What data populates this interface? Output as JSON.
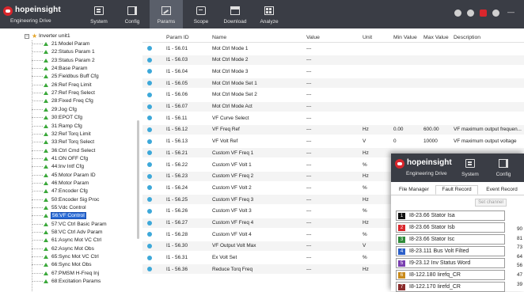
{
  "app": {
    "brand": "hopeinsight",
    "subtitle": "Engineering Drive"
  },
  "toolbar": [
    {
      "label": "System",
      "icon": "system-icon"
    },
    {
      "label": "Config",
      "icon": "config-icon"
    },
    {
      "label": "Params",
      "icon": "params-icon",
      "active": true
    },
    {
      "label": "Scope",
      "icon": "scope-icon"
    },
    {
      "label": "Download",
      "icon": "download-icon"
    },
    {
      "label": "Analyze",
      "icon": "analyze-icon"
    }
  ],
  "window_controls": {
    "minimize": "—"
  },
  "tree": {
    "root": "Inverter unit1",
    "items": [
      "21:Model Param",
      "22:Status Param 1",
      "23:Status Param 2",
      "24:Base Param",
      "25:Fieldbus Buff Cfg",
      "26:Ref Freq Limit",
      "27:Ref Freq Select",
      "28:Fixed Freq Cfg",
      "29:Jog Cfg",
      "30:EPOT Cfg",
      "31:Ramp Cfg",
      "32:Ref Torq Limit",
      "33:Ref Torq Select",
      "36:Ctrl Cmd Select",
      "41:ON OFF Cfg",
      "44:Inv Intf Cfg",
      "45:Motor Param ID",
      "46:Motor Param",
      "47:Encoder Cfg",
      "50:Encoder Sig Proc",
      "55:Vdc Control",
      "56:VF Control",
      "57:VC Ctrl Basic Param",
      "58:VC Ctrl Adv Param",
      "61:Async Mot VC Ctrl",
      "62:Async Mot Obs",
      "65:Sync Mot VC Ctrl",
      "66:Sync Mot Obs",
      "67:PMSM H-Freq Inj",
      "68:Excitation Params"
    ],
    "selected_index": 21
  },
  "table": {
    "headers": {
      "id": "Param ID",
      "name": "Name",
      "value": "Value",
      "unit": "Unit",
      "min": "Min Value",
      "max": "Max Value",
      "desc": "Description"
    },
    "rows": [
      {
        "id": "I1 - 56.01",
        "name": "Mot Ctrl Mode 1",
        "value": "---",
        "unit": "",
        "min": "",
        "max": "",
        "desc": ""
      },
      {
        "id": "I1 - 56.03",
        "name": "Mot Ctrl Mode 2",
        "value": "---",
        "unit": "",
        "min": "",
        "max": "",
        "desc": ""
      },
      {
        "id": "I1 - 56.04",
        "name": "Mot Ctrl Mode 3",
        "value": "---",
        "unit": "",
        "min": "",
        "max": "",
        "desc": ""
      },
      {
        "id": "I1 - 56.05",
        "name": "Mot Ctrl Mode Set 1",
        "value": "---",
        "unit": "",
        "min": "",
        "max": "",
        "desc": ""
      },
      {
        "id": "I1 - 56.06",
        "name": "Mot Ctrl Mode Set 2",
        "value": "---",
        "unit": "",
        "min": "",
        "max": "",
        "desc": ""
      },
      {
        "id": "I1 - 56.07",
        "name": "Mot Ctrl Mode Act",
        "value": "---",
        "unit": "",
        "min": "",
        "max": "",
        "desc": ""
      },
      {
        "id": "I1 - 56.11",
        "name": "VF Curve Select",
        "value": "---",
        "unit": "",
        "min": "",
        "max": "",
        "desc": ""
      },
      {
        "id": "I1 - 56.12",
        "name": "VF Freq Ref",
        "value": "---",
        "unit": "Hz",
        "min": "0.00",
        "max": "600.00",
        "desc": "VF maximum output frequen..."
      },
      {
        "id": "I1 - 56.13",
        "name": "VF Volt Ref",
        "value": "---",
        "unit": "V",
        "min": "0",
        "max": "10000",
        "desc": "VF maximum output voltage"
      },
      {
        "id": "I1 - 56.21",
        "name": "Custom VF Freq 1",
        "value": "---",
        "unit": "Hz",
        "min": "",
        "max": "",
        "desc": ""
      },
      {
        "id": "I1 - 56.22",
        "name": "Custom VF Volt 1",
        "value": "---",
        "unit": "%",
        "min": "",
        "max": "",
        "desc": ""
      },
      {
        "id": "I1 - 56.23",
        "name": "Custom VF Freq 2",
        "value": "---",
        "unit": "Hz",
        "min": "",
        "max": "",
        "desc": ""
      },
      {
        "id": "I1 - 56.24",
        "name": "Custom VF Volt 2",
        "value": "---",
        "unit": "%",
        "min": "",
        "max": "",
        "desc": ""
      },
      {
        "id": "I1 - 56.25",
        "name": "Custom VF Freq 3",
        "value": "---",
        "unit": "Hz",
        "min": "",
        "max": "",
        "desc": ""
      },
      {
        "id": "I1 - 56.26",
        "name": "Custom VF Volt 3",
        "value": "---",
        "unit": "%",
        "min": "",
        "max": "",
        "desc": ""
      },
      {
        "id": "I1 - 56.27",
        "name": "Custom VF Freq 4",
        "value": "---",
        "unit": "Hz",
        "min": "",
        "max": "",
        "desc": ""
      },
      {
        "id": "I1 - 56.28",
        "name": "Custom VF Volt 4",
        "value": "---",
        "unit": "%",
        "min": "",
        "max": "",
        "desc": ""
      },
      {
        "id": "I1 - 56.30",
        "name": "VF Output Volt Max",
        "value": "---",
        "unit": "V",
        "min": "",
        "max": "",
        "desc": ""
      },
      {
        "id": "I1 - 56.31",
        "name": "Ex Volt Set",
        "value": "---",
        "unit": "%",
        "min": "",
        "max": "",
        "desc": ""
      },
      {
        "id": "I1 - 56.36",
        "name": "Reduce Torq Freq",
        "value": "---",
        "unit": "Hz",
        "min": "",
        "max": "",
        "desc": ""
      }
    ]
  },
  "popup": {
    "brand": "hopeinsight",
    "subtitle": "Engineering Drive",
    "toolbar": [
      {
        "label": "System",
        "icon": "system-icon"
      },
      {
        "label": "Config",
        "icon": "config-icon"
      }
    ],
    "tabs": [
      "File Manager",
      "Fault Record",
      "Event Record"
    ],
    "active_tab": 1,
    "set_channel": "Set channel",
    "channels": [
      {
        "num": "1",
        "label": "I8-23.66 Stator Isa",
        "color": "#111111"
      },
      {
        "num": "2",
        "label": "I8-23.66 Stator Isb",
        "color": "#d9262c"
      },
      {
        "num": "3",
        "label": "I8-23.66 Stator Isc",
        "color": "#2e8b3a"
      },
      {
        "num": "4",
        "label": "I8-23.111 Bus Volt Filted",
        "color": "#2b5fc9"
      },
      {
        "num": "5",
        "label": "I9-23.12 Inv Status Word",
        "color": "#7a3fb0"
      },
      {
        "num": "6",
        "label": "I8-122.180 Iirefq_CR",
        "color": "#c98a1a"
      },
      {
        "num": "7",
        "label": "I8-122.170 Iirefd_CR",
        "color": "#8a2b2b"
      }
    ],
    "side_numbers": [
      "90",
      "81",
      "73",
      "64",
      "56",
      "47",
      "39"
    ]
  }
}
